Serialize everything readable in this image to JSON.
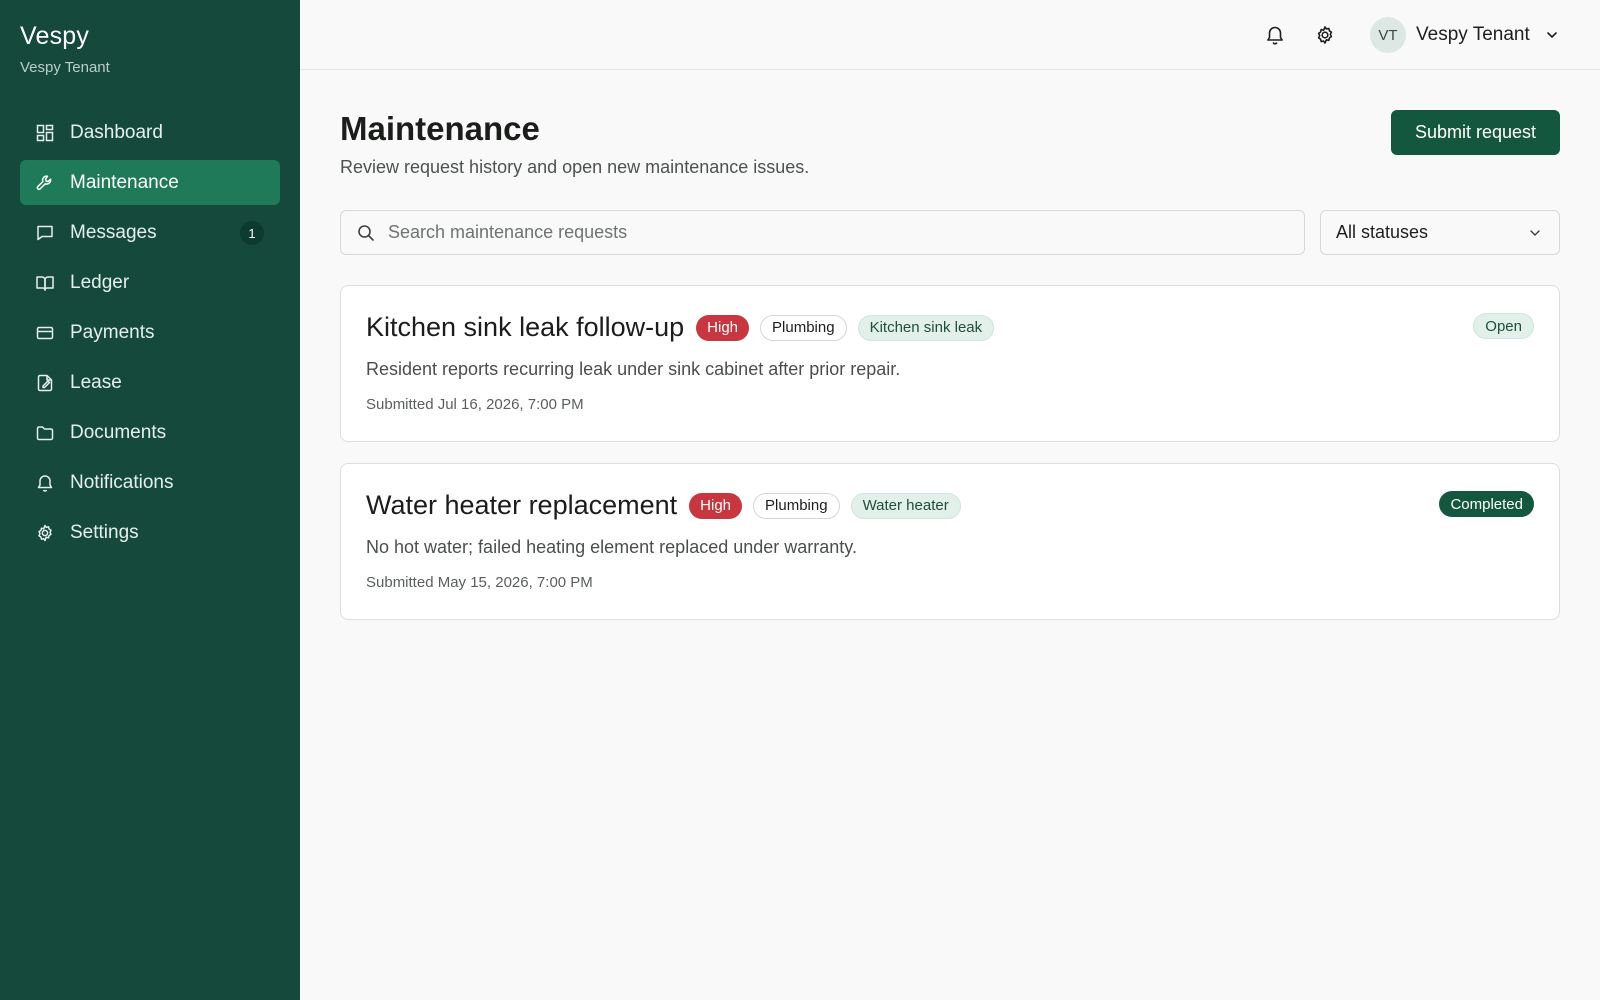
{
  "brand": {
    "name": "Vespy",
    "subtitle": "Vespy Tenant"
  },
  "sidebar": {
    "items": [
      {
        "label": "Dashboard",
        "icon": "dashboard-icon"
      },
      {
        "label": "Maintenance",
        "icon": "wrench-icon",
        "active": true
      },
      {
        "label": "Messages",
        "icon": "message-icon",
        "badge": "1"
      },
      {
        "label": "Ledger",
        "icon": "book-icon"
      },
      {
        "label": "Payments",
        "icon": "credit-card-icon"
      },
      {
        "label": "Lease",
        "icon": "lease-document-icon"
      },
      {
        "label": "Documents",
        "icon": "folder-icon"
      },
      {
        "label": "Notifications",
        "icon": "bell-icon"
      },
      {
        "label": "Settings",
        "icon": "gear-icon"
      }
    ]
  },
  "topbar": {
    "icons": [
      "bell-icon",
      "gear-icon"
    ],
    "user": {
      "initials": "VT",
      "name": "Vespy Tenant"
    }
  },
  "main": {
    "title": "Maintenance",
    "subtitle": "Review request history and open new maintenance issues.",
    "submit_label": "Submit request",
    "search": {
      "placeholder": "Search maintenance requests",
      "value": ""
    },
    "status_filter": {
      "selected": "All statuses"
    },
    "requests": [
      {
        "title": "Kitchen sink leak follow-up",
        "priority": "High",
        "category": "Plumbing",
        "tag": "Kitchen sink leak",
        "status": "Open",
        "description": "Resident reports recurring leak under sink cabinet after prior repair.",
        "submitted": "Submitted Jul 16, 2026, 7:00 PM"
      },
      {
        "title": "Water heater replacement",
        "priority": "High",
        "category": "Plumbing",
        "tag": "Water heater",
        "status": "Completed",
        "description": "No hot water; failed heating element replaced under warranty.",
        "submitted": "Submitted May 15, 2026, 7:00 PM"
      }
    ]
  },
  "colors": {
    "sidebar_bg": "#14493b",
    "sidebar_active": "#1f7a5a",
    "primary_button": "#14573f",
    "priority_high": "#c8373f",
    "tag_bg": "#e1f1e9"
  }
}
